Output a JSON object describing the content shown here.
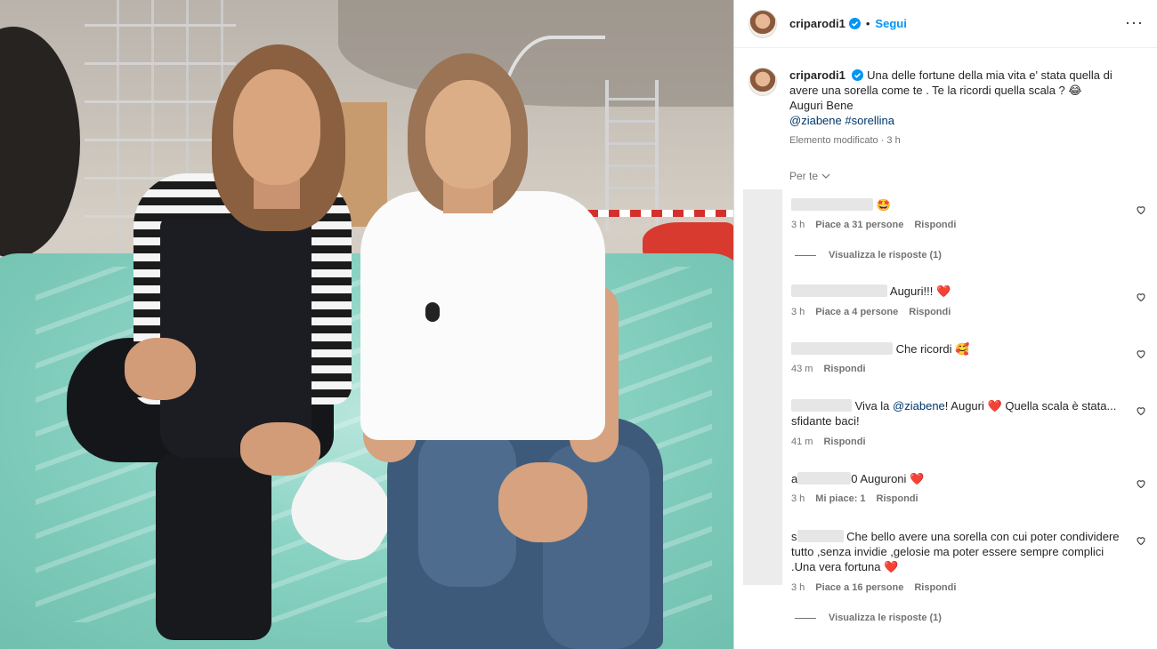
{
  "post": {
    "username": "criparodi1",
    "separator": "•",
    "follow_label": "Segui",
    "more_label": "···",
    "caption_line1": "Una delle fortune della mia vita e' stata quella di avere una sorella come te . Te la ricordi quella scala ?",
    "caption_emoji": "😂",
    "caption_line2": "Auguri Bene",
    "mention": "@ziabene",
    "hashtag": "#sorellina",
    "edited_meta": "Elemento modificato · 3 h"
  },
  "sort": {
    "label": "Per te",
    "chevron": "⌵"
  },
  "comments": [
    {
      "prefix": "",
      "text": "",
      "emoji": "🤩",
      "time": "3 h",
      "likes": "Piace a 31 persone",
      "reply": "Rispondi",
      "view_replies": "Visualizza le risposte (1)"
    },
    {
      "prefix": "",
      "text": "Auguri!!!",
      "emoji": "❤️",
      "time": "3 h",
      "likes": "Piace a 4 persone",
      "reply": "Rispondi"
    },
    {
      "prefix": "",
      "text": "Che ricordi",
      "emoji": "🥰",
      "time": "43 m",
      "reply": "Rispondi"
    },
    {
      "prefix": "",
      "text_before": "Viva la",
      "mention": "@ziabene",
      "text_after": "! Auguri",
      "emoji": "❤️",
      "text_tail": "Quella scala è stata...",
      "text_line2": "sfidante baci!",
      "time": "41 m",
      "reply": "Rispondi"
    },
    {
      "prefix": "a",
      "mask_suffix": "0",
      "text": "Auguroni",
      "emoji": "❤️",
      "time": "3 h",
      "likes": "Mi piace: 1",
      "reply": "Rispondi"
    },
    {
      "prefix": "s",
      "text": "Che bello avere una sorella con cui poter condividere",
      "text_line2": "tutto ,senza invidie ,gelosie ma poter essere sempre complici",
      "text_line3": ".Una vera fortuna",
      "emoji": "❤️",
      "time": "3 h",
      "likes": "Piace a 16 persone",
      "reply": "Rispondi",
      "view_replies": "Visualizza le risposte (1)"
    }
  ],
  "colors": {
    "link": "#00376b",
    "follow": "#0095f6",
    "verified": "#0095f6",
    "meta": "#737373"
  }
}
